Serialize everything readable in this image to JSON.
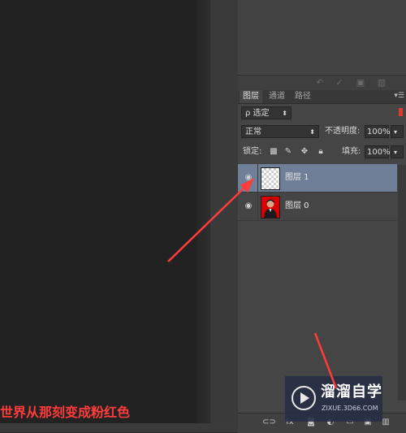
{
  "canvas": {
    "caption": "世界从那刻变成粉红色"
  },
  "history_toolbar": {
    "icons": [
      "undo-icon",
      "check-icon",
      "new-doc-icon",
      "trash-icon"
    ]
  },
  "layers_panel": {
    "tabs": [
      {
        "label": "图层",
        "active": true
      },
      {
        "label": "通道",
        "active": false
      },
      {
        "label": "路径",
        "active": false
      }
    ],
    "filter": {
      "label": "ρ 选定",
      "icon": "search-icon"
    },
    "blend_mode": {
      "value": "正常"
    },
    "opacity": {
      "label": "不透明度:",
      "value": "100%"
    },
    "lock": {
      "label": "锁定:"
    },
    "fill": {
      "label": "填充:",
      "value": "100%"
    },
    "layers": [
      {
        "name": "图层 1",
        "selected": true,
        "visible": true,
        "thumbnail": "transparent"
      },
      {
        "name": "图层 0",
        "selected": false,
        "visible": true,
        "thumbnail": "photo"
      }
    ]
  },
  "watermark": {
    "title": "溜溜自学",
    "subtitle": "ZIXUE.3D66.COM"
  },
  "annotation_color": "#ff3b3b",
  "selection_color": "#6f7f97"
}
